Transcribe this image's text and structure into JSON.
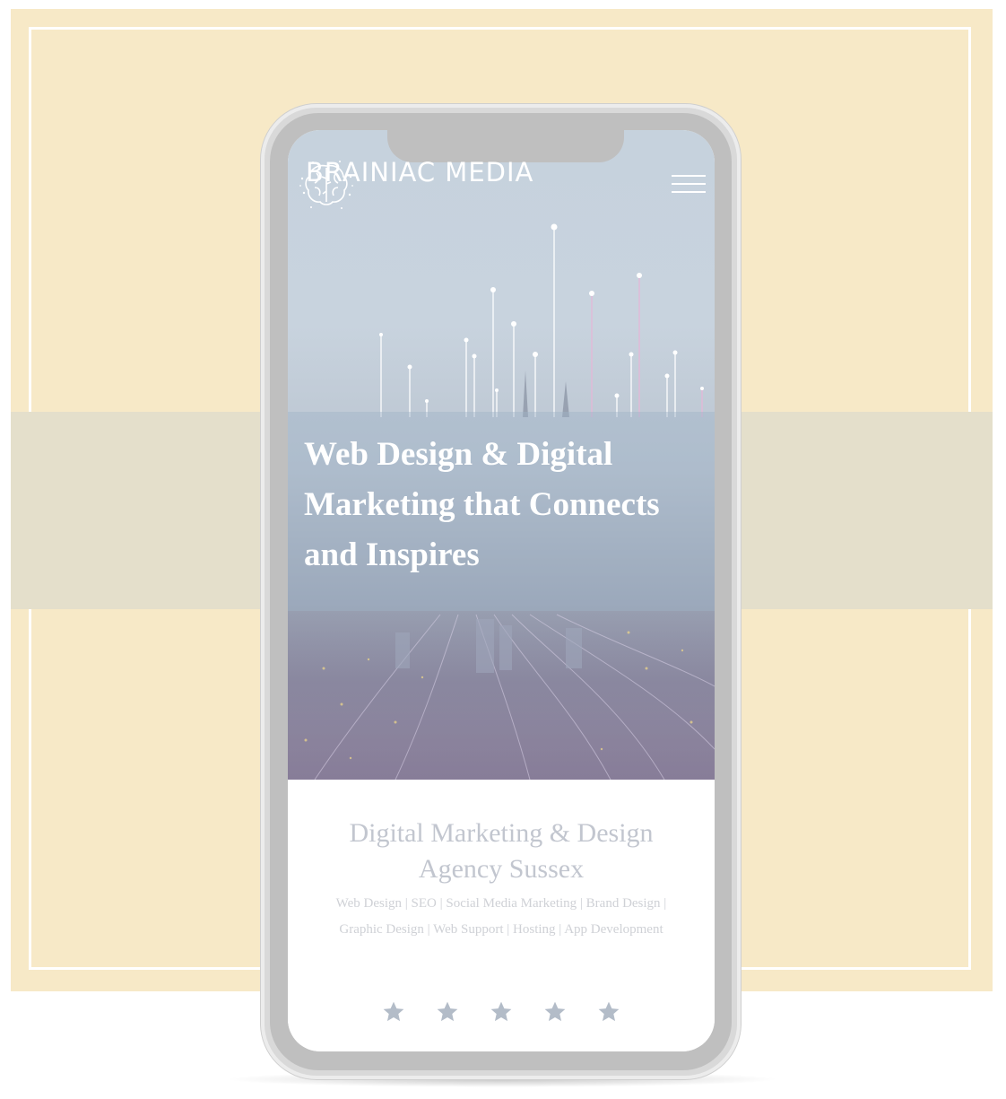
{
  "brand": {
    "name": "BRAINIAC MEDIA",
    "logo_icon": "brain-icon"
  },
  "nav": {
    "menu_icon": "hamburger-icon"
  },
  "hero": {
    "headline": "Web Design & Digital Marketing that Connects and Inspires"
  },
  "intro": {
    "title": "Digital Marketing & Design Agency Sussex",
    "services": "Web Design | SEO | Social Media Marketing | Brand Design | Graphic Design | Web Support | Hosting | App Development"
  },
  "rating": {
    "stars": 5,
    "icon": "star-icon"
  },
  "colors": {
    "background": "#f7e9c7",
    "band": "#e4dfcb",
    "phone_frame": "#d9d9d9",
    "hero_text": "#ffffff",
    "subtitle_text": "#c2c6cf",
    "star": "#b3bcc8"
  }
}
